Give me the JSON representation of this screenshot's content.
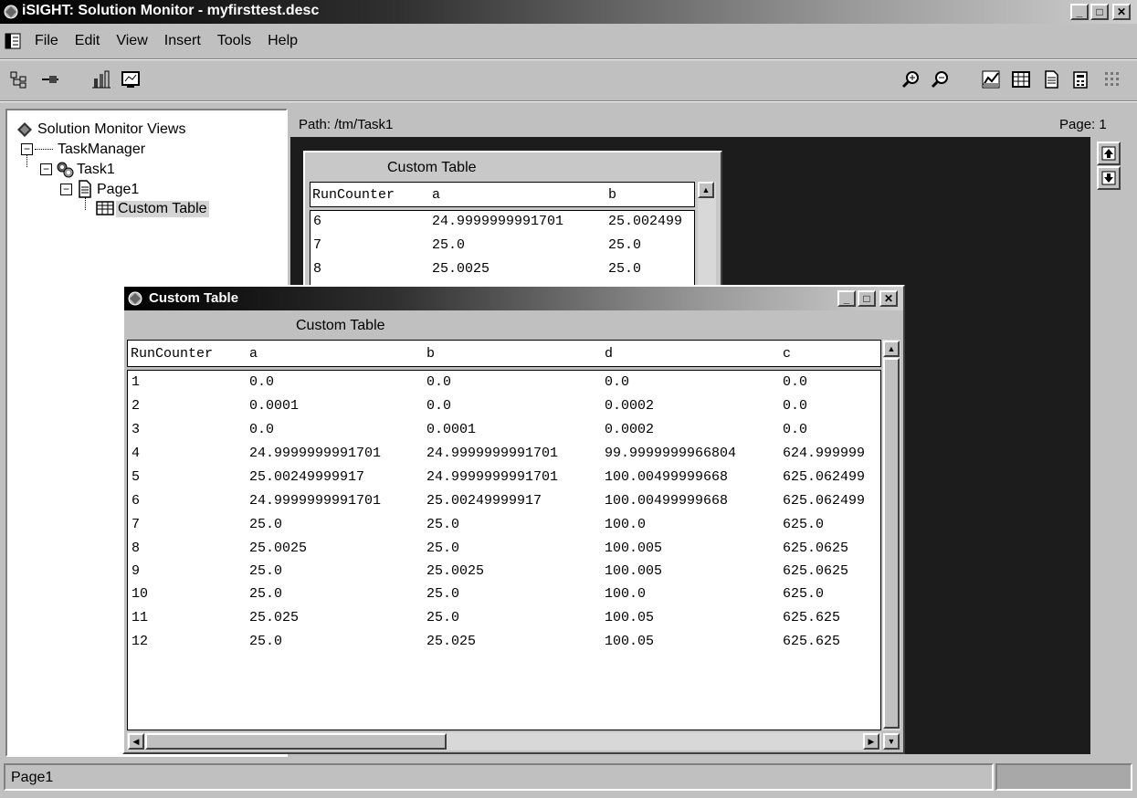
{
  "window": {
    "title": "iSIGHT: Solution Monitor - myfirsttest.desc"
  },
  "menu": [
    "File",
    "Edit",
    "View",
    "Insert",
    "Tools",
    "Help"
  ],
  "toolbar": {
    "left_icons": [
      "tree-view-icon",
      "link-icon",
      "chart-page-icon",
      "monitor-icon"
    ],
    "right_icons": [
      "zoom-in-icon",
      "zoom-out-icon",
      "line-chart-icon",
      "table-icon",
      "document-icon",
      "calculator-icon",
      "grid-dots-icon"
    ]
  },
  "tree": {
    "root": "Solution Monitor Views",
    "items": [
      "TaskManager",
      "Task1",
      "Page1",
      "Custom Table"
    ]
  },
  "main": {
    "path": "Path: /tm/Task1",
    "page": "Page: 1"
  },
  "background_table": {
    "title": "Custom Table",
    "columns": [
      "RunCounter",
      "a",
      "b"
    ],
    "rows": [
      [
        "6",
        "24.9999999991701",
        "25.002499"
      ],
      [
        "7",
        "25.0",
        "25.0"
      ],
      [
        "8",
        "25.0025",
        "25.0"
      ]
    ]
  },
  "custom_table_window": {
    "title": "Custom Table",
    "heading": "Custom Table",
    "columns": [
      "RunCounter",
      "a",
      "b",
      "d",
      "c"
    ],
    "rows": [
      [
        "1",
        "0.0",
        "0.0",
        "0.0",
        "0.0"
      ],
      [
        "2",
        "0.0001",
        "0.0",
        "0.0002",
        "0.0"
      ],
      [
        "3",
        "0.0",
        "0.0001",
        "0.0002",
        "0.0"
      ],
      [
        "4",
        "24.9999999991701",
        "24.9999999991701",
        "99.9999999966804",
        "624.999999"
      ],
      [
        "5",
        "25.00249999917",
        "24.9999999991701",
        "100.00499999668",
        "625.062499"
      ],
      [
        "6",
        "24.9999999991701",
        "25.00249999917",
        "100.00499999668",
        "625.062499"
      ],
      [
        "7",
        "25.0",
        "25.0",
        "100.0",
        "625.0"
      ],
      [
        "8",
        "25.0025",
        "25.0",
        "100.005",
        "625.0625"
      ],
      [
        "9",
        "25.0",
        "25.0025",
        "100.005",
        "625.0625"
      ],
      [
        "10",
        "25.0",
        "25.0",
        "100.0",
        "625.0"
      ],
      [
        "11",
        "25.025",
        "25.0",
        "100.05",
        "625.625"
      ],
      [
        "12",
        "25.0",
        "25.025",
        "100.05",
        "625.625"
      ]
    ]
  },
  "status": {
    "text": "Page1"
  }
}
